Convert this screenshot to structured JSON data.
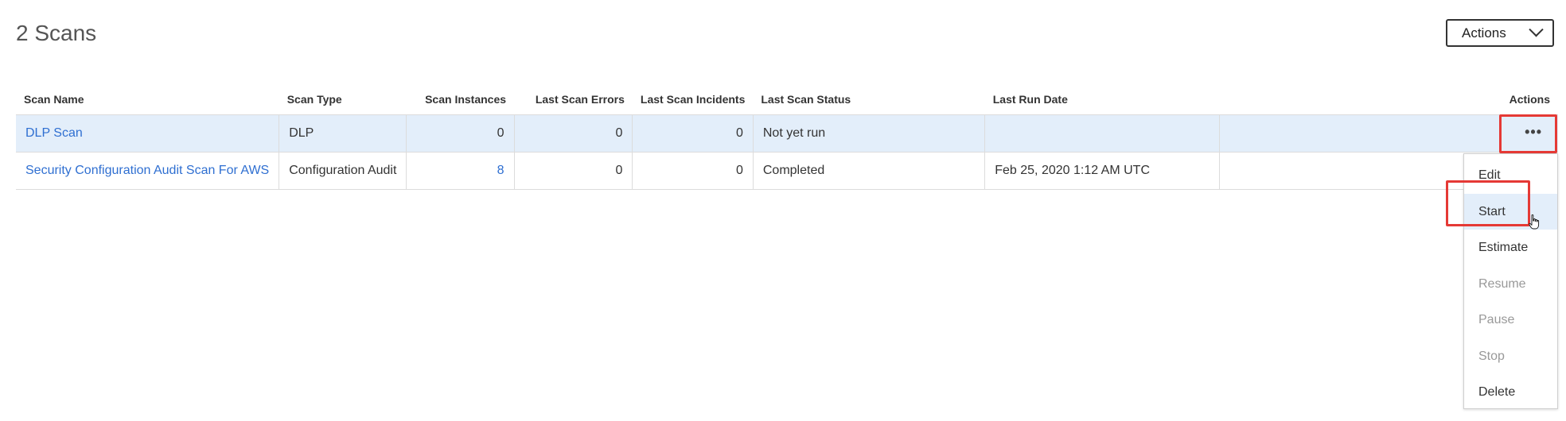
{
  "page": {
    "title": "2 Scans"
  },
  "header": {
    "actions_label": "Actions"
  },
  "table": {
    "columns": [
      "Scan Name",
      "Scan Type",
      "Scan Instances",
      "Last Scan Errors",
      "Last Scan Incidents",
      "Last Scan Status",
      "Last Run Date",
      "Actions"
    ],
    "rows": [
      {
        "name": "DLP Scan",
        "type": "DLP",
        "instances": "0",
        "errors": "0",
        "incidents": "0",
        "status": "Not yet run",
        "last_run": "",
        "actions": "•••"
      },
      {
        "name": "Security Configuration Audit Scan For AWS",
        "type": "Configuration Audit",
        "instances": "8",
        "errors": "0",
        "incidents": "0",
        "status": "Completed",
        "last_run": "Feb 25, 2020 1:12 AM UTC",
        "actions": ""
      }
    ]
  },
  "menu": {
    "items": [
      {
        "label": "Edit",
        "enabled": true
      },
      {
        "label": "Start",
        "enabled": true,
        "hovered": true
      },
      {
        "label": "Estimate",
        "enabled": true
      },
      {
        "label": "Resume",
        "enabled": false
      },
      {
        "label": "Pause",
        "enabled": false
      },
      {
        "label": "Stop",
        "enabled": false
      },
      {
        "label": "Delete",
        "enabled": true
      }
    ]
  },
  "colors": {
    "link": "#2f6fd1",
    "selected_row": "#e3eefa",
    "highlight": "#e53935",
    "disabled_text": "#999999"
  },
  "icons": {
    "more": "more-horizontal-icon",
    "chevron": "chevron-down-icon",
    "cursor": "hand-pointer-icon"
  }
}
